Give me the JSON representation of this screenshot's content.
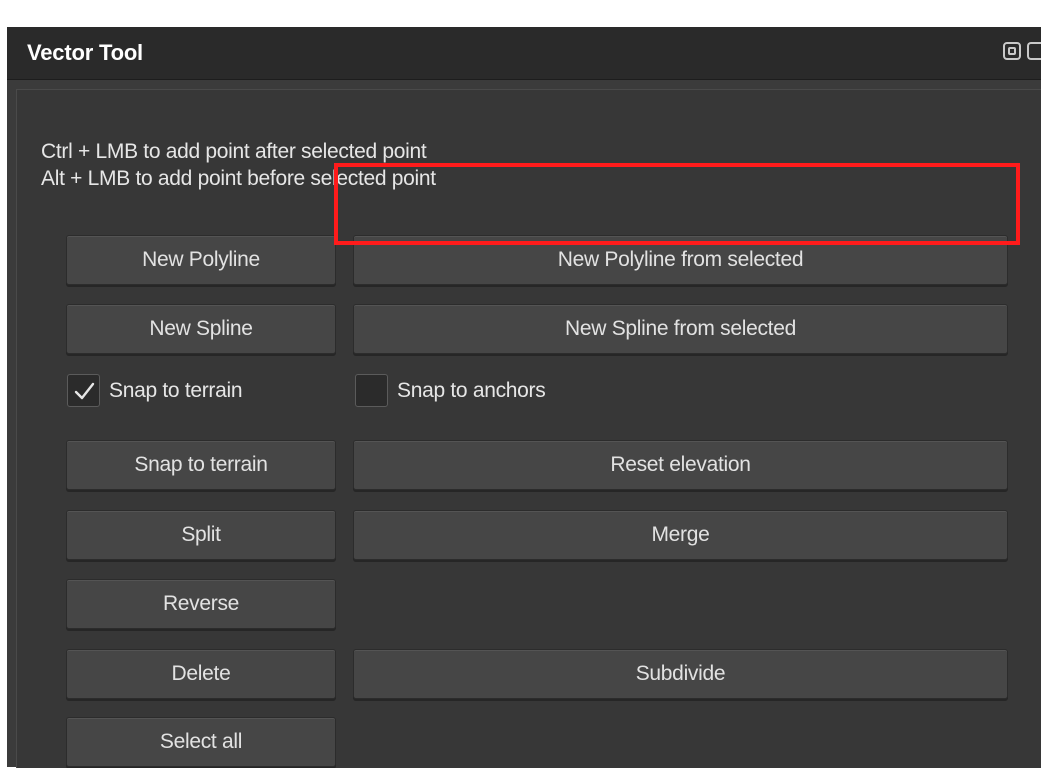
{
  "window": {
    "title": "Vector Tool"
  },
  "hints": [
    "Ctrl + LMB to add point after selected point",
    "Alt + LMB to add point before selected point"
  ],
  "buttons": {
    "new_polyline": "New Polyline",
    "new_polyline_from_selected": "New Polyline from selected",
    "new_spline": "New Spline",
    "new_spline_from_selected": "New Spline from selected",
    "snap_to_terrain": "Snap to terrain",
    "reset_elevation": "Reset elevation",
    "split": "Split",
    "merge": "Merge",
    "reverse": "Reverse",
    "delete": "Delete",
    "subdivide": "Subdivide",
    "select_all": "Select all"
  },
  "checkboxes": {
    "snap_to_terrain": {
      "label": "Snap to terrain",
      "checked": true
    },
    "snap_to_anchors": {
      "label": "Snap to anchors",
      "checked": false
    }
  },
  "icons": {
    "float": "float-window-icon",
    "close": "close-icon",
    "checkmark": "checkmark-icon"
  },
  "colors": {
    "highlight": "#ff1b1b",
    "panel_bg": "#373737",
    "button_bg": "#464646",
    "titlebar_bg": "#2a2a2a"
  }
}
